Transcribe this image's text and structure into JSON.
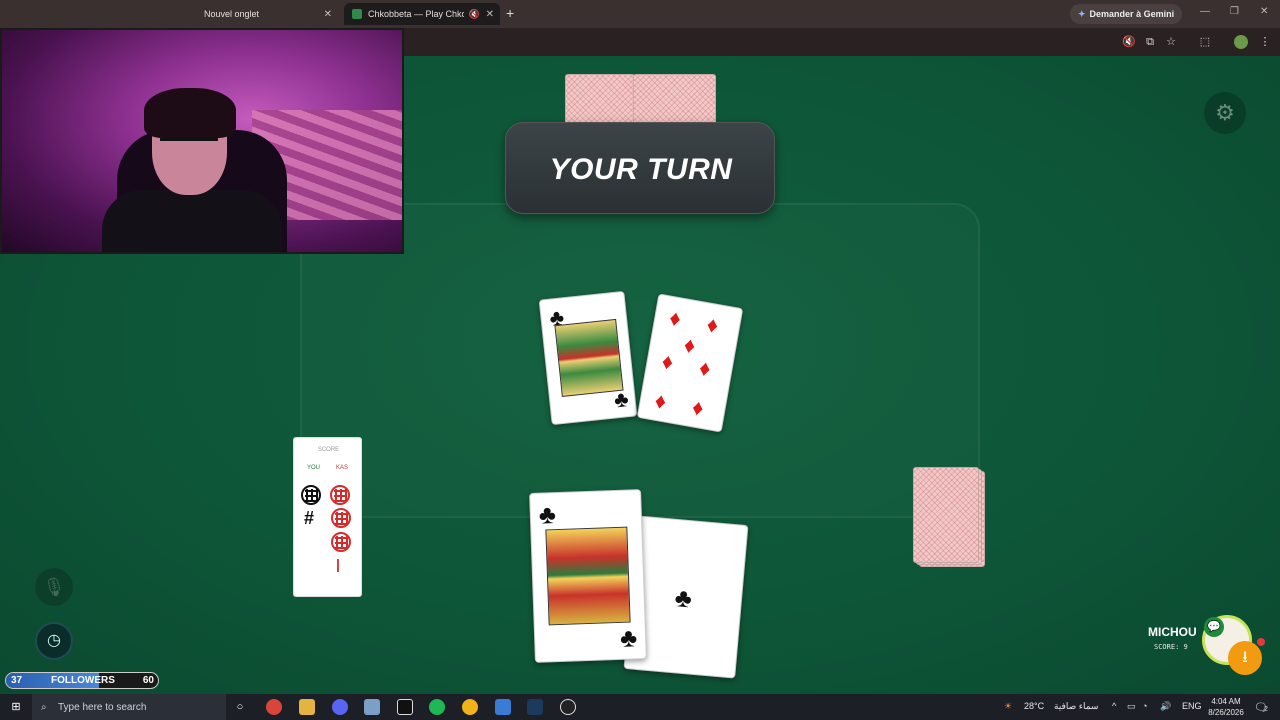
{
  "browser": {
    "tabs": [
      {
        "label": "Nouvel onglet",
        "close": "✕"
      },
      {
        "label": "Chkobbeta — Play Chkobb",
        "close": "✕"
      }
    ],
    "new_tab": "+",
    "gemini_label": "Demander à Gemini"
  },
  "game": {
    "banner": "YOUR TURN",
    "settings_icon": "gear-icon",
    "table_cards": [
      {
        "rank": "Queen",
        "suit": "♣"
      },
      {
        "rank": "6",
        "suit": "♦"
      }
    ],
    "hand_cards": [
      {
        "rank": "King",
        "suit": "♣"
      },
      {
        "rank": "1",
        "suit": "♣"
      }
    ],
    "scorecard": {
      "title": "SCORE",
      "col_you": "YOU",
      "col_opponent": "KAS",
      "you_marks_extra": "#",
      "kas_marks_extra": "|"
    },
    "player": {
      "name": "MICHOU",
      "score_label": "SCORE: 9"
    },
    "colors": {
      "felt": "#0e5638",
      "accent_orange": "#f29a10",
      "banner": "#2f3539"
    }
  },
  "stream": {
    "followers_count": "37",
    "followers_label": "FOLLOWERS",
    "followers_goal": "60",
    "followers_progress_fraction": 0.61
  },
  "taskbar": {
    "search_placeholder": "Type here to search",
    "weather": "28°C",
    "weather_text": "سماء صافية",
    "language": "ENG",
    "time": "4:04 AM",
    "date": "8/26/2026",
    "notifications": "2"
  }
}
